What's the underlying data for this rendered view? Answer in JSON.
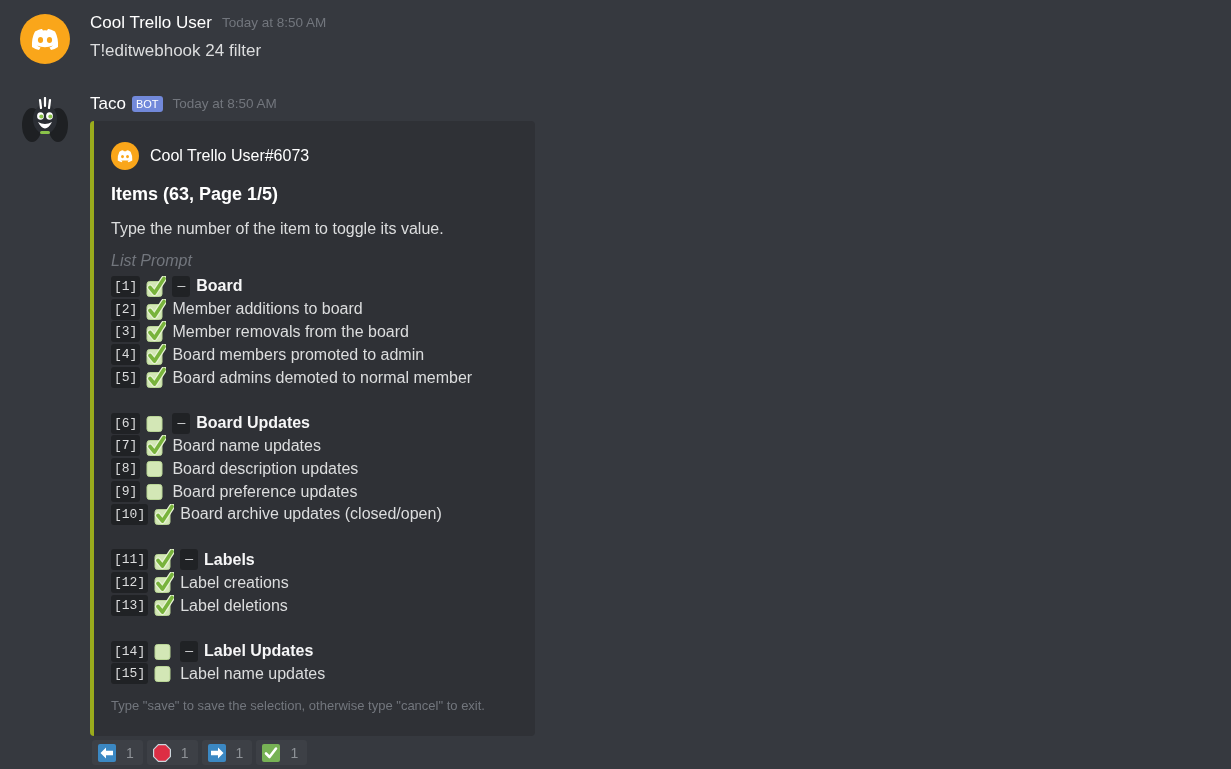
{
  "messages": [
    {
      "kind": "user",
      "author": "Cool Trello User",
      "timestamp": "Today at 8:50 AM",
      "content": "T!editwebhook 24 filter"
    },
    {
      "kind": "bot",
      "author": "Taco",
      "badge": "BOT",
      "timestamp": "Today at 8:50 AM",
      "embed": {
        "author": "Cool Trello User#6073",
        "title": "Items (63, Page 1/5)",
        "description": "Type the number of the item to toggle its value.",
        "list_label": "List Prompt",
        "groups": [
          {
            "items": [
              {
                "kind": "header",
                "number": "[1]",
                "checked": true,
                "marker": "—",
                "label": "Board"
              },
              {
                "kind": "item",
                "number": "[2]",
                "checked": true,
                "label": "Member additions to board"
              },
              {
                "kind": "item",
                "number": "[3]",
                "checked": true,
                "label": "Member removals from the board"
              },
              {
                "kind": "item",
                "number": "[4]",
                "checked": true,
                "label": "Board members promoted to admin"
              },
              {
                "kind": "item",
                "number": "[5]",
                "checked": true,
                "label": "Board admins demoted to normal member"
              }
            ]
          },
          {
            "items": [
              {
                "kind": "header",
                "number": "[6]",
                "checked": false,
                "marker": "—",
                "label": "Board Updates"
              },
              {
                "kind": "item",
                "number": "[7]",
                "checked": true,
                "label": "Board name updates"
              },
              {
                "kind": "item",
                "number": "[8]",
                "checked": false,
                "label": "Board description updates"
              },
              {
                "kind": "item",
                "number": "[9]",
                "checked": false,
                "label": "Board preference updates"
              },
              {
                "kind": "item",
                "number": "[10]",
                "checked": true,
                "label": "Board archive updates (closed/open)"
              }
            ]
          },
          {
            "items": [
              {
                "kind": "header",
                "number": "[11]",
                "checked": true,
                "marker": "—",
                "label": "Labels"
              },
              {
                "kind": "item",
                "number": "[12]",
                "checked": true,
                "label": "Label creations"
              },
              {
                "kind": "item",
                "number": "[13]",
                "checked": true,
                "label": "Label deletions"
              }
            ]
          },
          {
            "items": [
              {
                "kind": "header",
                "number": "[14]",
                "checked": false,
                "marker": "—",
                "label": "Label Updates"
              },
              {
                "kind": "item",
                "number": "[15]",
                "checked": false,
                "label": "Label name updates"
              }
            ]
          }
        ],
        "footer": "Type \"save\" to save the selection, otherwise type \"cancel\" to exit."
      },
      "reactions": [
        {
          "kind": "left-arrow",
          "count": "1"
        },
        {
          "kind": "stop",
          "count": "1"
        },
        {
          "kind": "right-arrow",
          "count": "1"
        },
        {
          "kind": "check",
          "count": "1"
        }
      ]
    }
  ]
}
